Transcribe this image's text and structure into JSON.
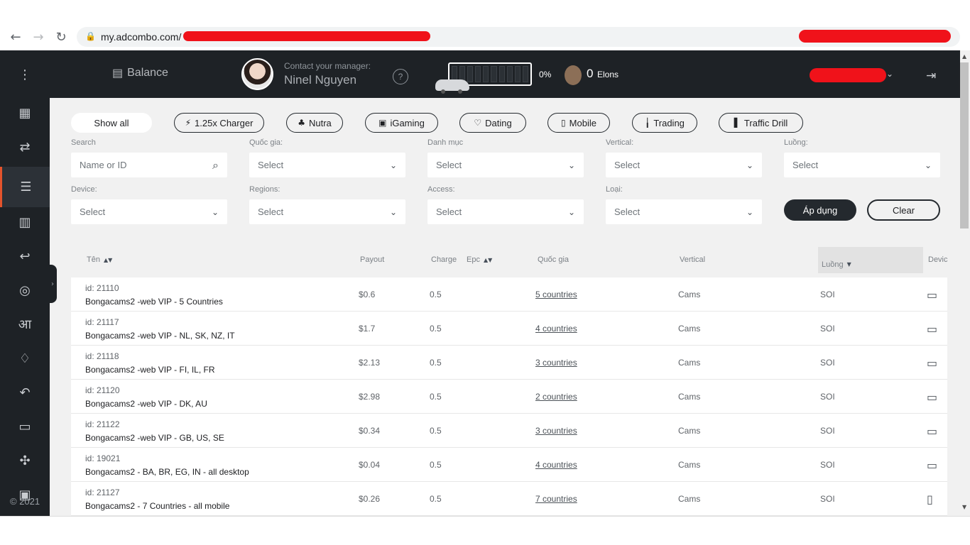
{
  "browser": {
    "url": "my.adcombo.com/"
  },
  "header": {
    "balance": "Balance",
    "contact_label": "Contact your manager:",
    "manager_name": "Ninel Nguyen",
    "help": "?",
    "progress_label": "0%",
    "progress": 0,
    "elons_count": "0",
    "elons_label": "Elons"
  },
  "sidebar": {
    "copyright": "© 2021",
    "items": [
      {
        "icon": "menu-dots-icon"
      },
      {
        "icon": "newspaper-icon"
      },
      {
        "icon": "shuffle-icon"
      },
      {
        "icon": "list-icon"
      },
      {
        "icon": "bar-chart-icon"
      },
      {
        "icon": "return-icon"
      },
      {
        "icon": "globe-icon"
      },
      {
        "icon": "language-icon"
      },
      {
        "icon": "bell-icon"
      },
      {
        "icon": "history-icon"
      },
      {
        "icon": "store-icon"
      },
      {
        "icon": "gift-icon"
      },
      {
        "icon": "calendar-icon"
      }
    ]
  },
  "filters": {
    "chips": [
      "Show all",
      "1.25x Charger",
      "Nutra",
      "iGaming",
      "Dating",
      "Mobile",
      "Trading",
      "Traffic Drill"
    ],
    "search_label": "Search",
    "search_placeholder": "Name or ID",
    "country_label": "Quốc gia:",
    "category_label": "Danh mục",
    "vertical_label": "Vertical:",
    "stream_label": "Luồng:",
    "device_label": "Device:",
    "regions_label": "Regions:",
    "access_label": "Access:",
    "type_label": "Loại:",
    "select": "Select",
    "apply": "Áp dụng",
    "clear": "Clear"
  },
  "table": {
    "headers": [
      "Tên",
      "Payout",
      "Charge",
      "Epc",
      "Quốc gia",
      "Vertical",
      "Luồng",
      "Devic"
    ],
    "rows": [
      {
        "id": "id: 21110",
        "name": "Bongacams2 -web VIP - 5 Countries",
        "payout": "$0.6",
        "charge": "0.5",
        "countries": "5 countries",
        "vertical": "Cams",
        "stream": "SOI",
        "device_icon": "laptop-icon"
      },
      {
        "id": "id: 21117",
        "name": "Bongacams2 -web VIP - NL, SK, NZ, IT",
        "payout": "$1.7",
        "charge": "0.5",
        "countries": "4 countries",
        "vertical": "Cams",
        "stream": "SOI",
        "device_icon": "laptop-icon"
      },
      {
        "id": "id: 21118",
        "name": "Bongacams2 -web VIP - FI, IL, FR",
        "payout": "$2.13",
        "charge": "0.5",
        "countries": "3 countries",
        "vertical": "Cams",
        "stream": "SOI",
        "device_icon": "laptop-icon"
      },
      {
        "id": "id: 21120",
        "name": "Bongacams2 -web VIP - DK, AU",
        "payout": "$2.98",
        "charge": "0.5",
        "countries": "2 countries",
        "vertical": "Cams",
        "stream": "SOI",
        "device_icon": "laptop-icon"
      },
      {
        "id": "id: 21122",
        "name": "Bongacams2 -web VIP - GB, US, SE",
        "payout": "$0.34",
        "charge": "0.5",
        "countries": "3 countries",
        "vertical": "Cams",
        "stream": "SOI",
        "device_icon": "laptop-icon"
      },
      {
        "id": "id: 19021",
        "name": "Bongacams2 - BA, BR, EG, IN - all desktop",
        "payout": "$0.04",
        "charge": "0.5",
        "countries": "4 countries",
        "vertical": "Cams",
        "stream": "SOI",
        "device_icon": "laptop-icon"
      },
      {
        "id": "id: 21127",
        "name": "Bongacams2 - 7 Countries - all mobile",
        "payout": "$0.26",
        "charge": "0.5",
        "countries": "7 countries",
        "vertical": "Cams",
        "stream": "SOI",
        "device_icon": "mobile-icon"
      }
    ]
  },
  "colors": {
    "sidebar_bg": "#1e2226",
    "accent": "#e4532c",
    "redaction": "#f0121a"
  }
}
